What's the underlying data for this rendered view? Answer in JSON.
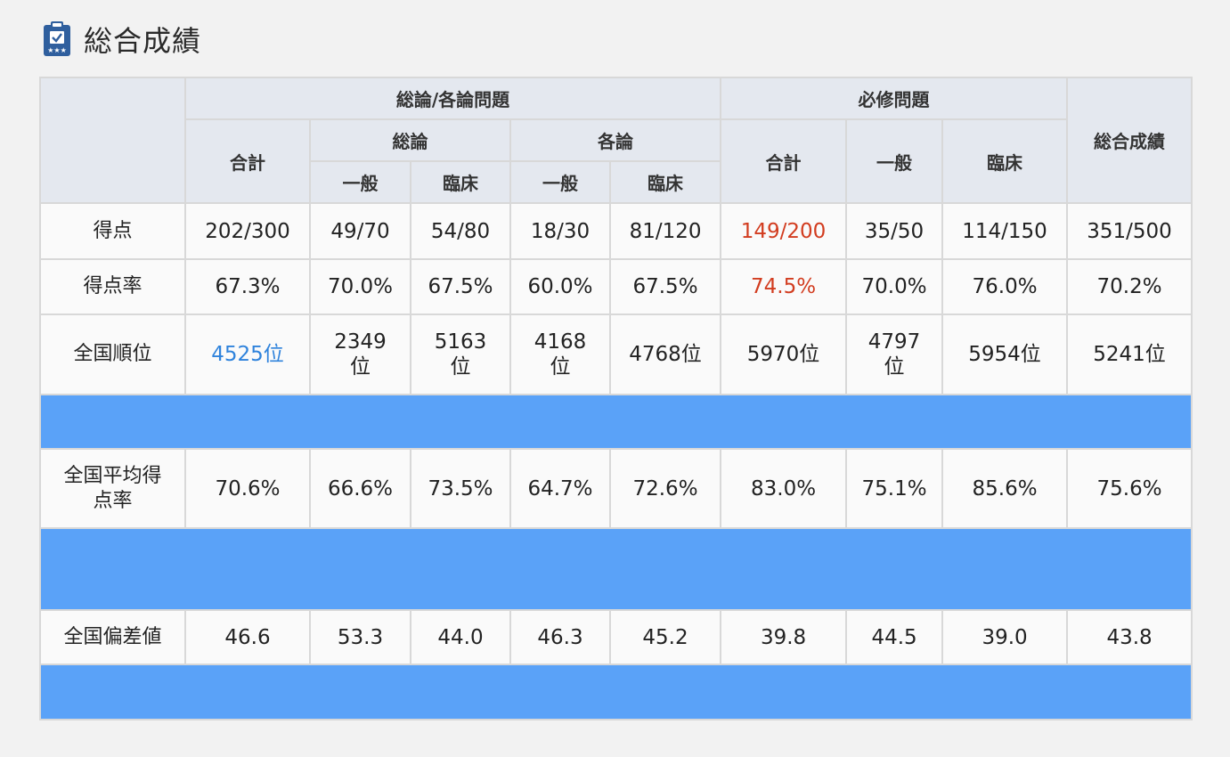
{
  "page": {
    "title": "総合成績",
    "icon": "clipboard-check-icon"
  },
  "table": {
    "headers": {
      "group_sougou_kakuron": "総論/各論問題",
      "group_hisshu": "必修問題",
      "total_score": "総合成績",
      "sub_goukei": "合計",
      "sub_souron": "総論",
      "sub_kakuron": "各論",
      "leaf_ippan_1": "一般",
      "leaf_rinsho_1": "臨床",
      "leaf_ippan_2": "一般",
      "leaf_rinsho_2": "臨床",
      "hisshu_goukei": "合計",
      "hisshu_ippan": "一般",
      "hisshu_rinsho": "臨床"
    },
    "rows": {
      "score": {
        "label": "得点",
        "cells": [
          "202/300",
          "49/70",
          "54/80",
          "18/30",
          "81/120",
          "149/200",
          "35/50",
          "114/150",
          "351/500"
        ]
      },
      "rate": {
        "label": "得点率",
        "cells": [
          "67.3%",
          "70.0%",
          "67.5%",
          "60.0%",
          "67.5%",
          "74.5%",
          "70.0%",
          "76.0%",
          "70.2%"
        ]
      },
      "rank": {
        "label": "全国順位",
        "cells": [
          "4525位",
          "2349\n位",
          "5163\n位",
          "4168\n位",
          "4768位",
          "5970位",
          "4797\n位",
          "5954位",
          "5241位"
        ]
      },
      "avg_rate": {
        "label": "全国平均得点率",
        "cells": [
          "70.6%",
          "66.6%",
          "73.5%",
          "64.7%",
          "72.6%",
          "83.0%",
          "75.1%",
          "85.6%",
          "75.6%"
        ]
      },
      "deviation": {
        "label": "全国偏差値",
        "cells": [
          "46.6",
          "53.3",
          "44.0",
          "46.3",
          "45.2",
          "39.8",
          "44.5",
          "39.0",
          "43.8"
        ]
      }
    },
    "colors": {
      "header_bg": "#e4e8ef",
      "row_bg": "#fafafa",
      "blue_band": "#5aa2f8",
      "highlight_red": "#d23c1f",
      "link_blue": "#2f83dc"
    }
  }
}
